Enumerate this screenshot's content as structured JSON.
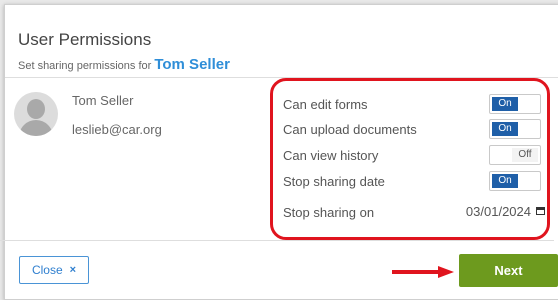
{
  "dialog": {
    "title": "User Permissions",
    "subtitle_prefix": "Set sharing permissions for",
    "subtitle_name": "Tom Seller"
  },
  "user": {
    "name": "Tom Seller",
    "email": "leslieb@car.org"
  },
  "permissions": [
    {
      "label": "Can edit forms",
      "state": "On"
    },
    {
      "label": "Can upload documents",
      "state": "On"
    },
    {
      "label": "Can view history",
      "state": "Off"
    },
    {
      "label": "Stop sharing date",
      "state": "On"
    }
  ],
  "stop_sharing": {
    "label": "Stop sharing on",
    "date": "03/01/2024"
  },
  "footer": {
    "close_label": "Close",
    "close_icon": "×",
    "next_label": "Next"
  },
  "colors": {
    "accent_blue": "#2f8ed8",
    "toggle_on": "#1f5fa8",
    "next_green": "#6d9a1e",
    "annotation_red": "#e0141e"
  }
}
